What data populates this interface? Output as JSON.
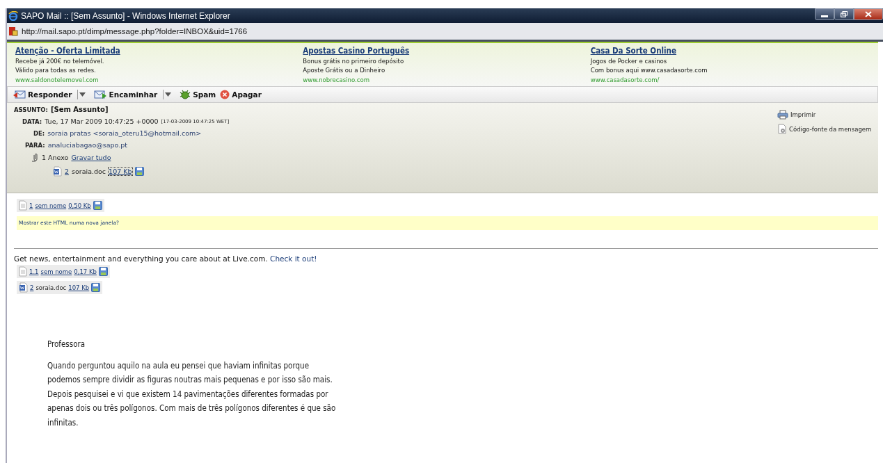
{
  "window": {
    "title": "SAPO Mail :: [Sem Assunto] - Windows Internet Explorer",
    "address": "http://mail.sapo.pt/dimp/message.php?folder=INBOX&uid=1766"
  },
  "ads": [
    {
      "title": "Atenção - Oferta Limitada",
      "lines": [
        "Recebe já 200€ no telemóvel.",
        "Válido para todas as redes."
      ],
      "url": "www.saldonotelemovel.com"
    },
    {
      "title": "Apostas Casino Português",
      "lines": [
        "Bonus grátis no primeiro depósito",
        "Aposte Grátis ou a Dinheiro"
      ],
      "url": "www.nobrecasino.com"
    },
    {
      "title": "Casa Da Sorte Online",
      "lines": [
        "Jogos de Pocker e casinos",
        "Com bonus aqui www.casadasorte.com"
      ],
      "url": "www.casadasorte.com/"
    }
  ],
  "toolbar": [
    {
      "kind": "reply",
      "label": "Responder",
      "dropdown": true
    },
    {
      "kind": "forward",
      "label": "Encaminhar",
      "dropdown": true
    },
    {
      "kind": "spam",
      "label": "Spam",
      "dropdown": false
    },
    {
      "kind": "delete",
      "label": "Apagar",
      "dropdown": false
    }
  ],
  "headers": {
    "subject_label": "ASSUNTO:",
    "subject": "[Sem Assunto]",
    "date_label": "DATA:",
    "date": "Tue, 17 Mar 2009 10:47:25 +0000",
    "date_local": "[17-03-2009 10:47:25 WET]",
    "from_label": "DE:",
    "from": "soraia pratas <soraia_oteru15@hotmail.com>",
    "to_label": "PARA:",
    "to": "analuciabagao@sapo.pt",
    "attach_count": "1 Anexo",
    "save_all": "Gravar tudo",
    "attachment": {
      "number": "2",
      "name": "soraia.doc",
      "size": "107 Kb"
    }
  },
  "actions": [
    {
      "kind": "print",
      "label": "Imprimir"
    },
    {
      "kind": "source",
      "label": "Código-fonte da mensagem"
    }
  ],
  "parts_top": [
    {
      "kind": "text",
      "number": "1",
      "name": "sem nome",
      "size": "0,50 Kb"
    }
  ],
  "html_notice": "Mostrar este HTML numa nova janela?",
  "footer_line": "Get news, entertainment and everything you care about at Live.com.",
  "footer_link": "Check it out!",
  "parts_bottom": [
    {
      "kind": "text",
      "number": "1.1",
      "name": "sem nome",
      "size": "0,17 Kb"
    },
    {
      "kind": "doc",
      "number": "2",
      "name": "soraia.doc",
      "size": "107 Kb"
    }
  ],
  "body": [
    "Professora",
    "Quando perguntou aquilo na aula eu pensei que haviam infinitas porque podemos sempre dividir as figuras  noutras mais pequenas e por isso são mais. Depois pesquisei e vi que existem 14 pavimentações diferentes formadas por apenas dois ou três polígonos. Com mais de três polígonos diferentes é que são infinitas."
  ]
}
